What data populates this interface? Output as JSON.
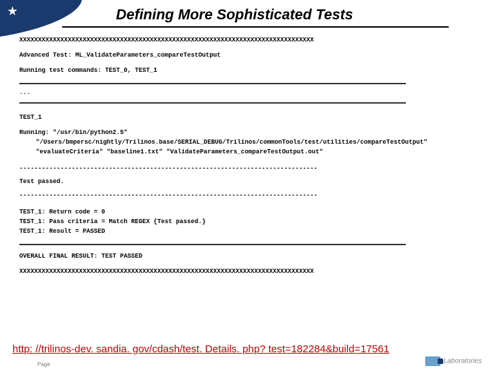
{
  "title": "Defining More Sophisticated Tests",
  "xrow": "XXXXXXXXXXXXXXXXXXXXXXXXXXXXXXXXXXXXXXXXXXXXXXXXXXXXXXXXXXXXXXXXXXXXXXXXXXXXXXX",
  "advanced_test": "Advanced Test: ML_ValidateParameters_compareTestOutput",
  "running": "Running test commands: TEST_0, TEST_1",
  "ellipsis": "...",
  "test_label": "TEST_1",
  "run_cmd_1": "Running: \"/usr/bin/python2.5\"",
  "run_cmd_2": "\"/Users/bmpersc/nightly/Trilinos.base/SERIAL_DEBUG/Trilinos/commonTools/test/utilities/compareTestOutput\"",
  "run_cmd_3": "\"evaluateCriteria\" \"baseline1.txt\" \"ValidateParameters_compareTestOutput.out\"",
  "dash_row": "--------------------------------------------------------------------------------",
  "test_passed": "Test passed.",
  "ret_code": "TEST_1: Return code = 0",
  "pass_crit": "TEST_1: Pass criteria = Match REGEX {Test passed.}",
  "result": "TEST_1: Result = PASSED",
  "overall": "OVERALL FINAL RESULT: TEST PASSED",
  "url": "http: //trilinos-dev. sandia. gov/cdash/test. Details. php? test=182284&build=17561",
  "footer_page": "Page",
  "footer_lab": "Laboratories"
}
